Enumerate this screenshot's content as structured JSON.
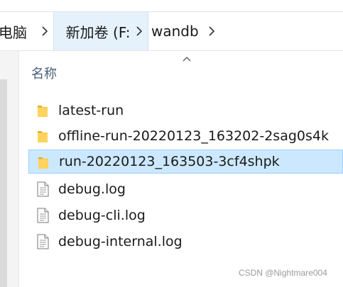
{
  "breadcrumb": {
    "items": [
      {
        "label": "电脑"
      },
      {
        "label": "新加卷 (F:)"
      },
      {
        "label": "wandb"
      }
    ]
  },
  "column_header": {
    "name": "名称"
  },
  "files": [
    {
      "name": "latest-run",
      "type": "folder",
      "selected": false
    },
    {
      "name": "offline-run-20220123_163202-2sag0s4k",
      "type": "folder",
      "selected": false
    },
    {
      "name": "run-20220123_163503-3cf4shpk",
      "type": "folder",
      "selected": true
    },
    {
      "name": "debug.log",
      "type": "file",
      "selected": false
    },
    {
      "name": "debug-cli.log",
      "type": "file",
      "selected": false
    },
    {
      "name": "debug-internal.log",
      "type": "file",
      "selected": false
    }
  ],
  "watermark": "CSDN @Nightmare004",
  "colors": {
    "selection": "#cce8ff",
    "selection_border": "#99d1ff",
    "folder": "#f5c542"
  }
}
